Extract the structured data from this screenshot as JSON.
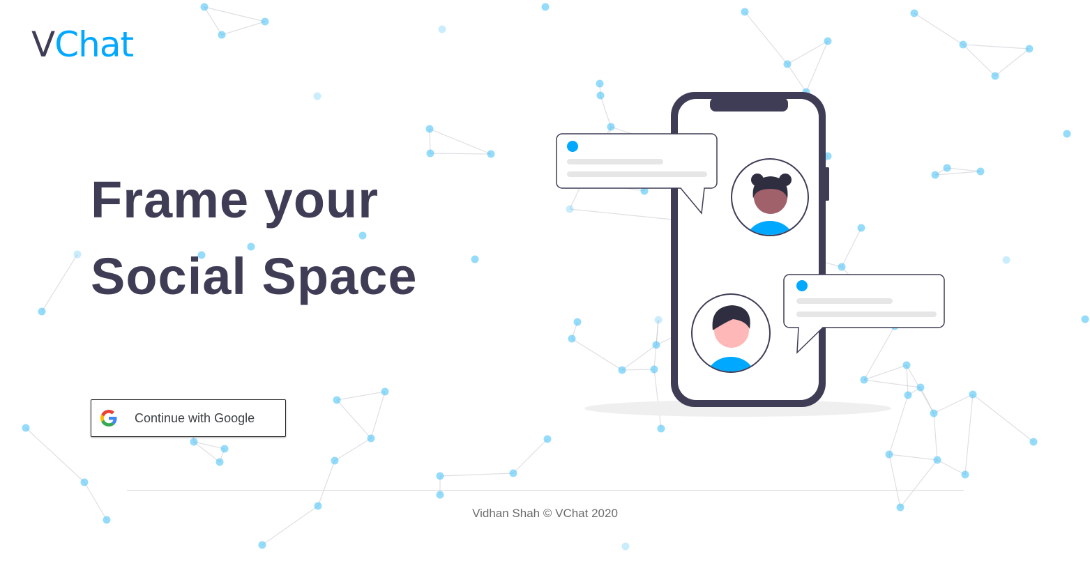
{
  "brand": {
    "prefix": "V",
    "suffix": "Chat"
  },
  "hero": {
    "line1": "Frame your",
    "line2": "Social Space"
  },
  "auth": {
    "google_label": "Continue with Google"
  },
  "footer": {
    "text": "Vidhan Shah © VChat 2020"
  },
  "colors": {
    "accent": "#00a8ff",
    "dark": "#3f3d56",
    "avatar_skin_1": "#a0616a",
    "avatar_skin_2": "#ffb8b8"
  },
  "icons": [
    "google-g-icon",
    "phone-illustration",
    "avatar-woman",
    "avatar-man",
    "chat-bubble"
  ]
}
